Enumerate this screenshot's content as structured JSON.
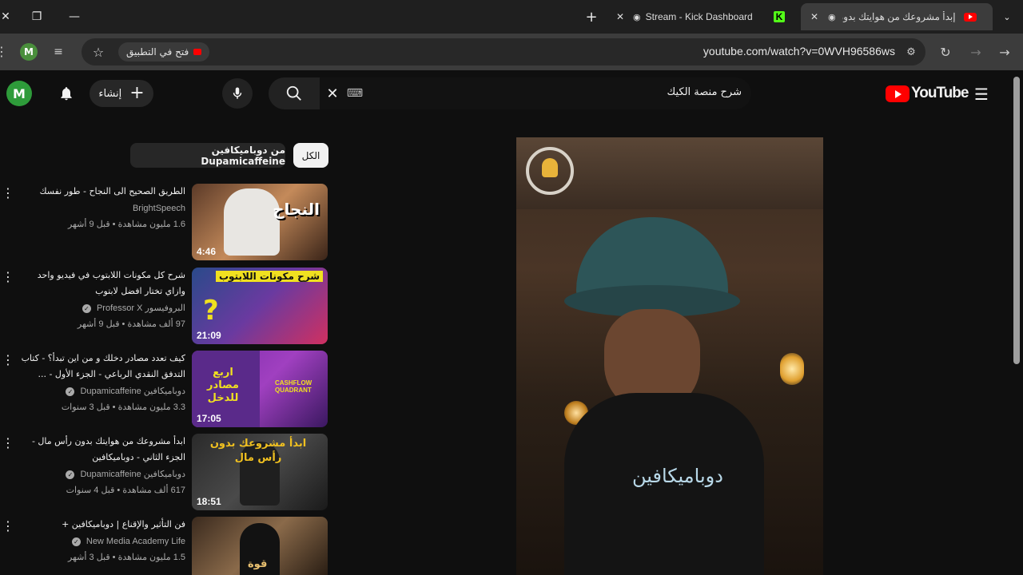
{
  "browser": {
    "tabs": [
      {
        "title": "إبدأ مشروعك من هوايتك بدون",
        "active": true
      },
      {
        "title": "",
        "icon": "kick-icon"
      },
      {
        "title": "Stream - Kick Dashboard"
      }
    ],
    "new_tab": "+",
    "url": "youtube.com/watch?v=0WVH96586ws",
    "open_in_app": "فتح في التطبيق",
    "profile_initial": "M"
  },
  "youtube": {
    "logo_text": "YouTube",
    "search_query": "شرح منصة الكيك",
    "create_label": "إنشاء",
    "avatar_initial": "M",
    "chips": [
      {
        "label": "الكل",
        "selected": true
      },
      {
        "label": "من دوباميكافين Dupamicaffeine",
        "selected": false
      }
    ],
    "recommendations": [
      {
        "title1": "الطريق الصحيح الى النجاح - طور نفسك",
        "title2": "",
        "channel": "BrightSpeech",
        "meta": "1.6 مليون مشاهدة • قبل 9 أشهر",
        "duration": "4:46",
        "verified": false,
        "thumb_text": "النجاح"
      },
      {
        "title1": "شرح كل مكونات اللابتوب في فيديو واحد",
        "title2": "وازاي تختار افضل لابتوب",
        "channel": "البروفيسور Professor X",
        "meta": "97 ألف مشاهدة • قبل 9 أشهر",
        "duration": "21:09",
        "verified": true,
        "thumb_text": "شرح مكونات اللابتوب"
      },
      {
        "title1": "كيف تعدد مصادر دخلك و من اين تبدأ؟ - كتاب",
        "title2": "التدفق النقدي الرباعي - الجزء الأول - ...",
        "channel": "دوباميكافين Dupamicaffeine",
        "meta": "3.3 مليون مشاهدة • قبل 3 سنوات",
        "duration": "17:05",
        "verified": true,
        "thumb_text": "اربع مصادر للدخل"
      },
      {
        "title1": "ابدأ مشروعك من هوايتك بدون رأس مال -",
        "title2": "الجزء الثاني - دوباميكافين",
        "channel": "دوباميكافين Dupamicaffeine",
        "meta": "617 ألف مشاهدة • قبل 4 سنوات",
        "duration": "18:51",
        "verified": true,
        "thumb_text": "ابدأ مشروعك بدون رأس مال"
      },
      {
        "title1": "فن التأثير والإقناع | دوباميكافين +",
        "title2": "",
        "channel": "New Media Academy Life",
        "meta": "1.5 مليون مشاهدة • قبل 3 أشهر",
        "duration": "",
        "verified": true,
        "thumb_text": "قوة"
      }
    ],
    "player_overlay_text": "دوباميكافين"
  },
  "colors": {
    "yt_red": "#ff0000",
    "bg": "#0f0f0f",
    "avatar_green": "#2e9b3a"
  }
}
